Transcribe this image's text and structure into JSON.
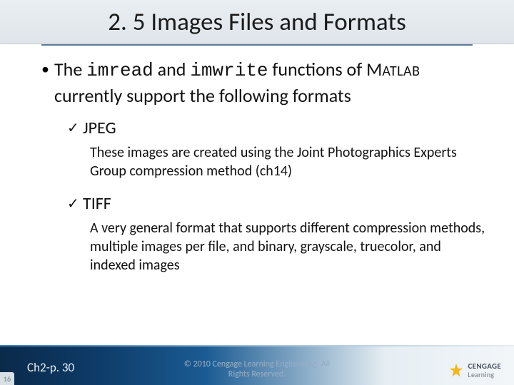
{
  "title": "2. 5 Images Files and Formats",
  "bullet": {
    "dot": "•",
    "pre": "The ",
    "fn1": "imread",
    "mid1": " and ",
    "fn2": "imwrite",
    "mid2": " functions of ",
    "matlab_m": "M",
    "matlab_rest": "ATLAB",
    "post": " currently support the following formats"
  },
  "items": [
    {
      "check": "✓",
      "label": " JPEG",
      "desc": "These images are created using the Joint Photographics Experts Group compression method (ch14)"
    },
    {
      "check": "✓",
      "label": "TIFF",
      "desc": "A very general format that supports different compression methods, multiple images per file, and binary, grayscale, truecolor, and indexed images"
    }
  ],
  "footer": {
    "left": "Ch2-p. 30",
    "center_line1": "© 2010 Cengage Learning Engineering. All",
    "center_line2": "Rights Reserved.",
    "pagecorner": "16",
    "logo_top": "CENGAGE",
    "logo_bottom": "Learning"
  }
}
